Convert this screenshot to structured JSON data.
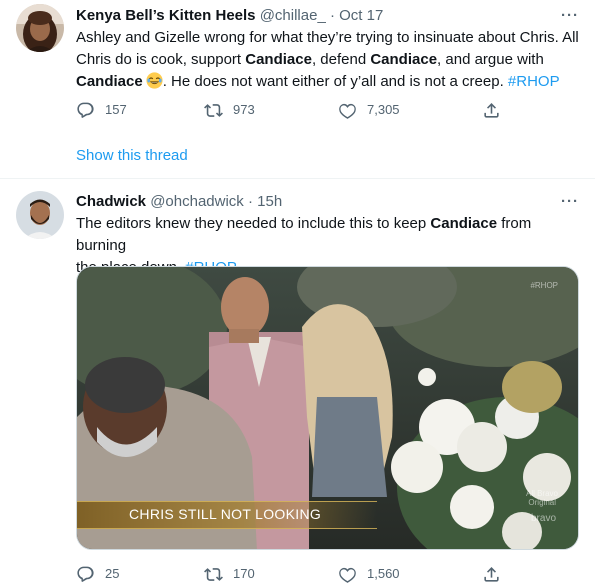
{
  "tweets": [
    {
      "name": "Kenya Bell’s Kitten Heels",
      "handle": "@chillae_",
      "separator": "·",
      "time": "Oct 17",
      "text": {
        "line1": "Ashley and Gizelle wrong for what they’re trying to insinuate about Chris. All",
        "line2_a": "Chris do is cook, support ",
        "line2_b": "Candiace",
        "line2_c": ", defend ",
        "line2_d": "Candiace",
        "line2_e": ", and argue with",
        "line3_a": "Candiace",
        "line3_c": ". He does not want either of y’all and is not a creep. ",
        "line3_tag": "#RHOP"
      },
      "stats": {
        "replies": "157",
        "retweets": "973",
        "likes": "7,305"
      },
      "show_thread": "Show this thread"
    },
    {
      "name": "Chadwick",
      "handle": "@ohchadwick",
      "separator": "·",
      "time": "15h",
      "text": {
        "line1_a": "The editors knew they needed to include this to keep ",
        "line1_b": "Candiace",
        "line1_c": " from burning",
        "line2_a": "the place down. ",
        "line2_tag": "#RHOP"
      },
      "media": {
        "caption": "CHRIS STILL NOT LOOKING",
        "watermark_top": "#RHOP",
        "watermark_brand": "bravo",
        "watermark_small_1": "All Bravo",
        "watermark_small_2": "Original"
      },
      "stats": {
        "replies": "25",
        "retweets": "170",
        "likes": "1,560"
      }
    }
  ],
  "more_label": "···",
  "icons": [
    "reply-icon",
    "retweet-icon",
    "like-icon",
    "share-icon",
    "more-icon",
    "laughing-emoji"
  ],
  "colors": {
    "link": "#1d9bf0",
    "muted": "#536471",
    "text": "#0f1419",
    "divider": "#eff3f4"
  }
}
